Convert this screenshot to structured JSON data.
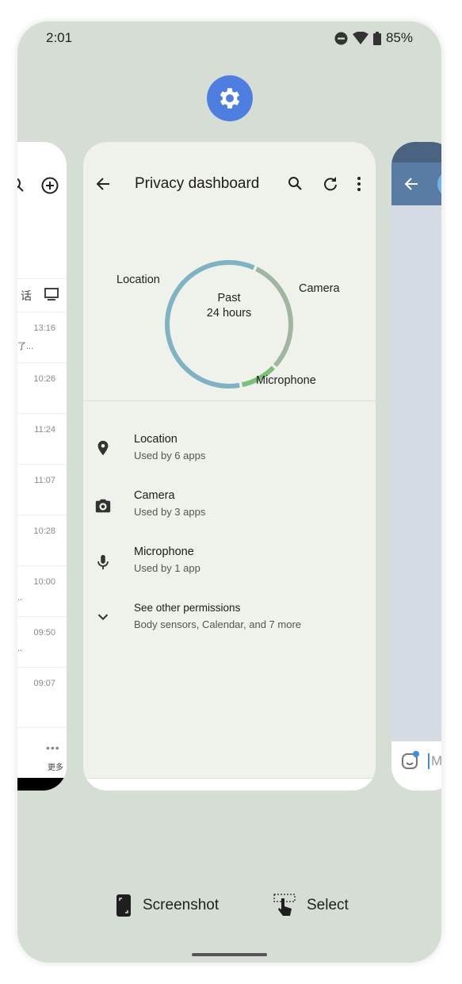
{
  "status_bar": {
    "time": "2:01",
    "battery": "85%",
    "icons": [
      "dnd-icon",
      "wifi-icon",
      "battery-icon"
    ]
  },
  "app_icon": "settings-gear-icon",
  "left_card": {
    "tab_text": "话",
    "times": [
      "13:16",
      "10:26",
      "11:24",
      "11:07",
      "10:28",
      "10:00",
      "09:50",
      "09:07"
    ],
    "previews": [
      "了...",
      "",
      "",
      "",
      "",
      "..",
      "..",
      ""
    ],
    "more_label": "更多"
  },
  "main_card": {
    "title": "Privacy dashboard",
    "donut_center": [
      "Past",
      "24 hours"
    ],
    "chart_data": {
      "type": "pie",
      "style": "donut",
      "categories": [
        "Location",
        "Camera",
        "Microphone"
      ],
      "values": [
        6,
        3,
        1
      ],
      "colors": [
        "#7fb3c4",
        "#a2b5a1",
        "#7cbf7a"
      ]
    },
    "permissions": [
      {
        "title": "Location",
        "subtitle": "Used by 6 apps",
        "icon": "location-pin-icon"
      },
      {
        "title": "Camera",
        "subtitle": "Used by 3 apps",
        "icon": "camera-icon"
      },
      {
        "title": "Microphone",
        "subtitle": "Used by 1 app",
        "icon": "microphone-icon"
      },
      {
        "title": "See other permissions",
        "subtitle": "Body sensors, Calendar, and 7 more",
        "icon": "chevron-down-icon"
      }
    ]
  },
  "right_card": {
    "input_placeholder": "Me"
  },
  "actions": {
    "screenshot": "Screenshot",
    "select": "Select"
  }
}
